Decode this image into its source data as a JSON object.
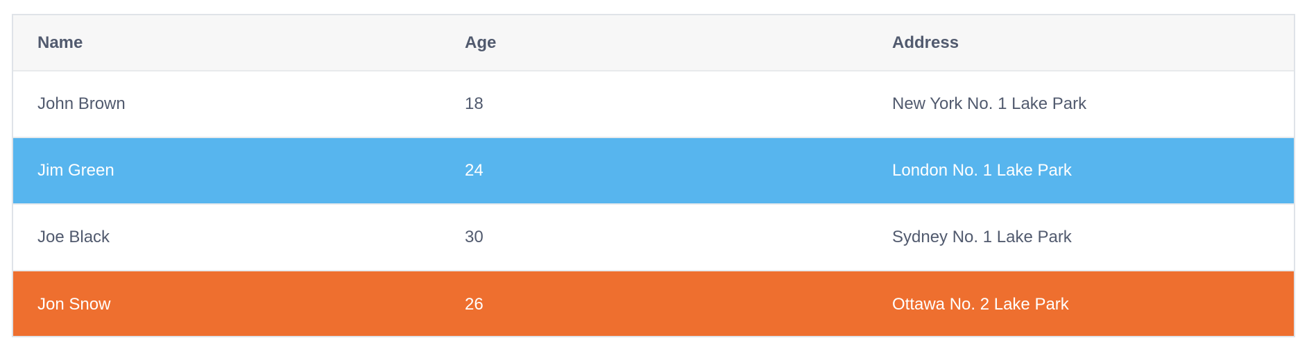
{
  "table": {
    "columns": [
      "Name",
      "Age",
      "Address"
    ],
    "rows": [
      {
        "name": "John Brown",
        "age": "18",
        "address": "New York No. 1 Lake Park",
        "style": "default"
      },
      {
        "name": "Jim Green",
        "age": "24",
        "address": "London No. 1 Lake Park",
        "style": "info"
      },
      {
        "name": "Joe Black",
        "age": "30",
        "address": "Sydney No. 1 Lake Park",
        "style": "default"
      },
      {
        "name": "Jon Snow",
        "age": "26",
        "address": "Ottawa No. 2 Lake Park",
        "style": "error"
      }
    ]
  },
  "colors": {
    "header_bg": "#f7f7f7",
    "text": "#515a6e",
    "info_row": "#57b5ee",
    "error_row": "#ee6f2f"
  }
}
